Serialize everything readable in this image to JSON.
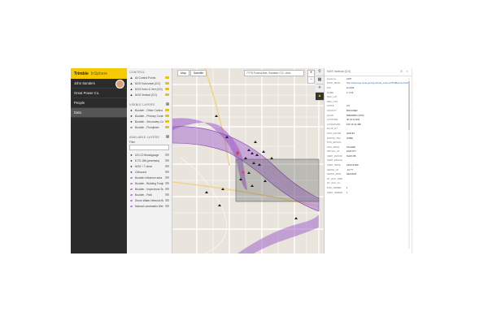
{
  "brand": {
    "logo": "Trimble",
    "product": "InSphere"
  },
  "nav": {
    "user": "John Sanders",
    "org": "Great Power Co.",
    "items": [
      {
        "label": "People"
      },
      {
        "label": "Data"
      }
    ]
  },
  "panel": {
    "control_header": "CONTROL",
    "control_layers": [
      {
        "label": "All Control Points",
        "icon": "▲"
      },
      {
        "label": "NGS Horizontal (CO)",
        "icon": "▲"
      },
      {
        "label": "NGS Horiz & Vert (CO)",
        "icon": "▲"
      },
      {
        "label": "NGS Vertical (CO)",
        "icon": "▲"
      }
    ],
    "visible_header": "VISIBLE LAYERS",
    "visible_layers": [
      {
        "label": "Boulder - Other Control",
        "icon": "●"
      },
      {
        "label": "Boulder - Primary Control",
        "icon": "●"
      },
      {
        "label": "Boulder - Secondary Con",
        "icon": "●"
      },
      {
        "label": "Boulder - Floodplain",
        "icon": "▰"
      }
    ],
    "available_header": "AVAILABLE LAYERS",
    "filter_label": "Filter",
    "filter_placeholder": "",
    "available_layers": [
      {
        "label": "US CO Broadgauge",
        "icon": "●"
      },
      {
        "label": "8 TO 188 (premises)",
        "icon": "●"
      },
      {
        "label": "NGS + T-clear",
        "icon": "●"
      },
      {
        "label": "CMsound",
        "icon": "●"
      },
      {
        "label": "Boulder Influence area",
        "icon": "▰"
      },
      {
        "label": "Boulder - Building Footprint",
        "icon": "▰"
      },
      {
        "label": "Boulder - Impervious Surf",
        "icon": "▰"
      },
      {
        "label": "Boulder - Park",
        "icon": "▰"
      },
      {
        "label": "Storm Water Network Bg",
        "icon": "▰"
      },
      {
        "label": "Natural Landmarks Wet",
        "icon": "▰"
      }
    ]
  },
  "map": {
    "type_map": "Map",
    "type_satellite": "Satellite",
    "search_value": "7775 Forest Ave, Boulder CO, Unit..",
    "zoom_in": "+",
    "zoom_out": "−"
  },
  "tools": [
    {
      "icon": "⚲"
    },
    {
      "icon": "▦"
    },
    {
      "icon": "⟡"
    },
    {
      "icon": "▲"
    }
  ],
  "info": {
    "title": "NGS Vertical (CO)",
    "attributes": [
      {
        "k": "Features",
        "v": "2167"
      },
      {
        "k": "DATA_SRCE",
        "v": "http://www.ngs.noaa.gov/cgi-bin/ds_mark.prl?PidBox=LL1224",
        "link": true
      },
      {
        "k": "PID",
        "v": "LL1224"
      },
      {
        "k": "NAME",
        "v": "C 71 E"
      },
      {
        "k": "DEC_LAT",
        "v": ""
      },
      {
        "k": "DEC_LON",
        "v": ""
      },
      {
        "k": "STATE",
        "v": "CO"
      },
      {
        "k": "COUNTY",
        "v": "BOULDER"
      },
      {
        "k": "QUAD",
        "v": "B0502809 (1979)"
      },
      {
        "k": "LATITUDE",
        "v": "40 01 01.304"
      },
      {
        "k": "LONGITUDE",
        "v": "105 15 41.386"
      },
      {
        "k": "ELLIP_HT",
        "v": ""
      },
      {
        "k": "POS_DATUM",
        "v": "NAD 83"
      },
      {
        "k": "DATUM_TAG",
        "v": "(1986)"
      },
      {
        "k": "POS_EPOCH",
        "v": ""
      },
      {
        "k": "POS_SRCE",
        "v": "SCALED"
      },
      {
        "k": "ORTHO_HT",
        "v": "1622.577"
      },
      {
        "k": "VERT_DATUM",
        "v": "NAVD 88"
      },
      {
        "k": "VERT_EPOCH",
        "v": ""
      },
      {
        "k": "VERT_SRCE",
        "v": "ADJUSTED"
      },
      {
        "k": "GEOID_HT",
        "v": "-15.77"
      },
      {
        "k": "GEOID_MOD",
        "v": "GEOID18"
      },
      {
        "k": "HT_ACC_ORD",
        "v": ""
      },
      {
        "k": "HT_ACC_CL",
        "v": ""
      },
      {
        "k": "POS_ORDER",
        "v": "1"
      },
      {
        "k": "VERT_ORDER",
        "v": "1"
      }
    ]
  },
  "colors": {
    "accent": "#f6c900",
    "flood": "#9b59c9",
    "nav": "#2b2b2b"
  }
}
